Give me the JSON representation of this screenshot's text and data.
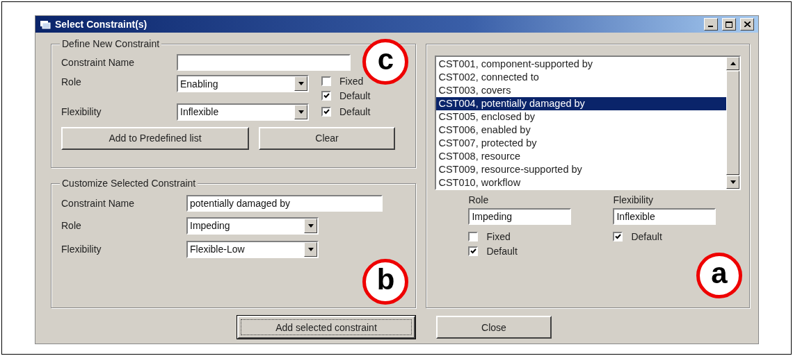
{
  "window": {
    "title": "Select Constraint(s)"
  },
  "define_new": {
    "title": "Define New Constraint",
    "annotation": "c",
    "name": {
      "label": "Constraint Name"
    },
    "role": {
      "label": "Role",
      "value": "Enabling"
    },
    "flexibility": {
      "label": "Flexibility",
      "value": "Inflexible"
    },
    "role_checkboxes": [
      {
        "label": "Fixed",
        "checked": false
      },
      {
        "label": "Default",
        "checked": true
      }
    ],
    "flexibility_checkboxes": [
      {
        "label": "Default",
        "checked": true
      }
    ],
    "buttons": [
      "Add to Predefined list",
      "Clear"
    ]
  },
  "customize": {
    "title": "Customize Selected Constraint",
    "annotation": "b",
    "name": {
      "label": "Constraint Name",
      "value": "potentially damaged by"
    },
    "role": {
      "label": "Role",
      "value": "Impeding"
    },
    "flexibility": {
      "label": "Flexibility",
      "value": "Flexible-Low"
    }
  },
  "constraints": {
    "annotation": "a",
    "items": [
      {
        "label": "CST001, component-supported by",
        "selected": false
      },
      {
        "label": "CST002, connected to",
        "selected": false
      },
      {
        "label": "CST003, covers",
        "selected": false
      },
      {
        "label": "CST004, potentially damaged by",
        "selected": true
      },
      {
        "label": "CST005, enclosed by",
        "selected": false
      },
      {
        "label": "CST006, enabled by",
        "selected": false
      },
      {
        "label": "CST007, protected by",
        "selected": false
      },
      {
        "label": "CST008, resource",
        "selected": false
      },
      {
        "label": "CST009, resource-supported by",
        "selected": false
      },
      {
        "label": "CST010, workflow",
        "selected": false
      }
    ],
    "role": {
      "label": "Role",
      "value": "Impeding",
      "checkboxes": [
        {
          "label": "Fixed",
          "checked": false
        },
        {
          "label": "Default",
          "checked": true
        }
      ]
    },
    "flexibility": {
      "label": "Flexibility",
      "value": "Inflexible",
      "checkboxes": [
        {
          "label": "Default",
          "checked": true
        }
      ]
    }
  },
  "buttons": [
    {
      "label": "Add selected constraint",
      "focused": true
    },
    {
      "label": "Close",
      "focused": false
    }
  ]
}
